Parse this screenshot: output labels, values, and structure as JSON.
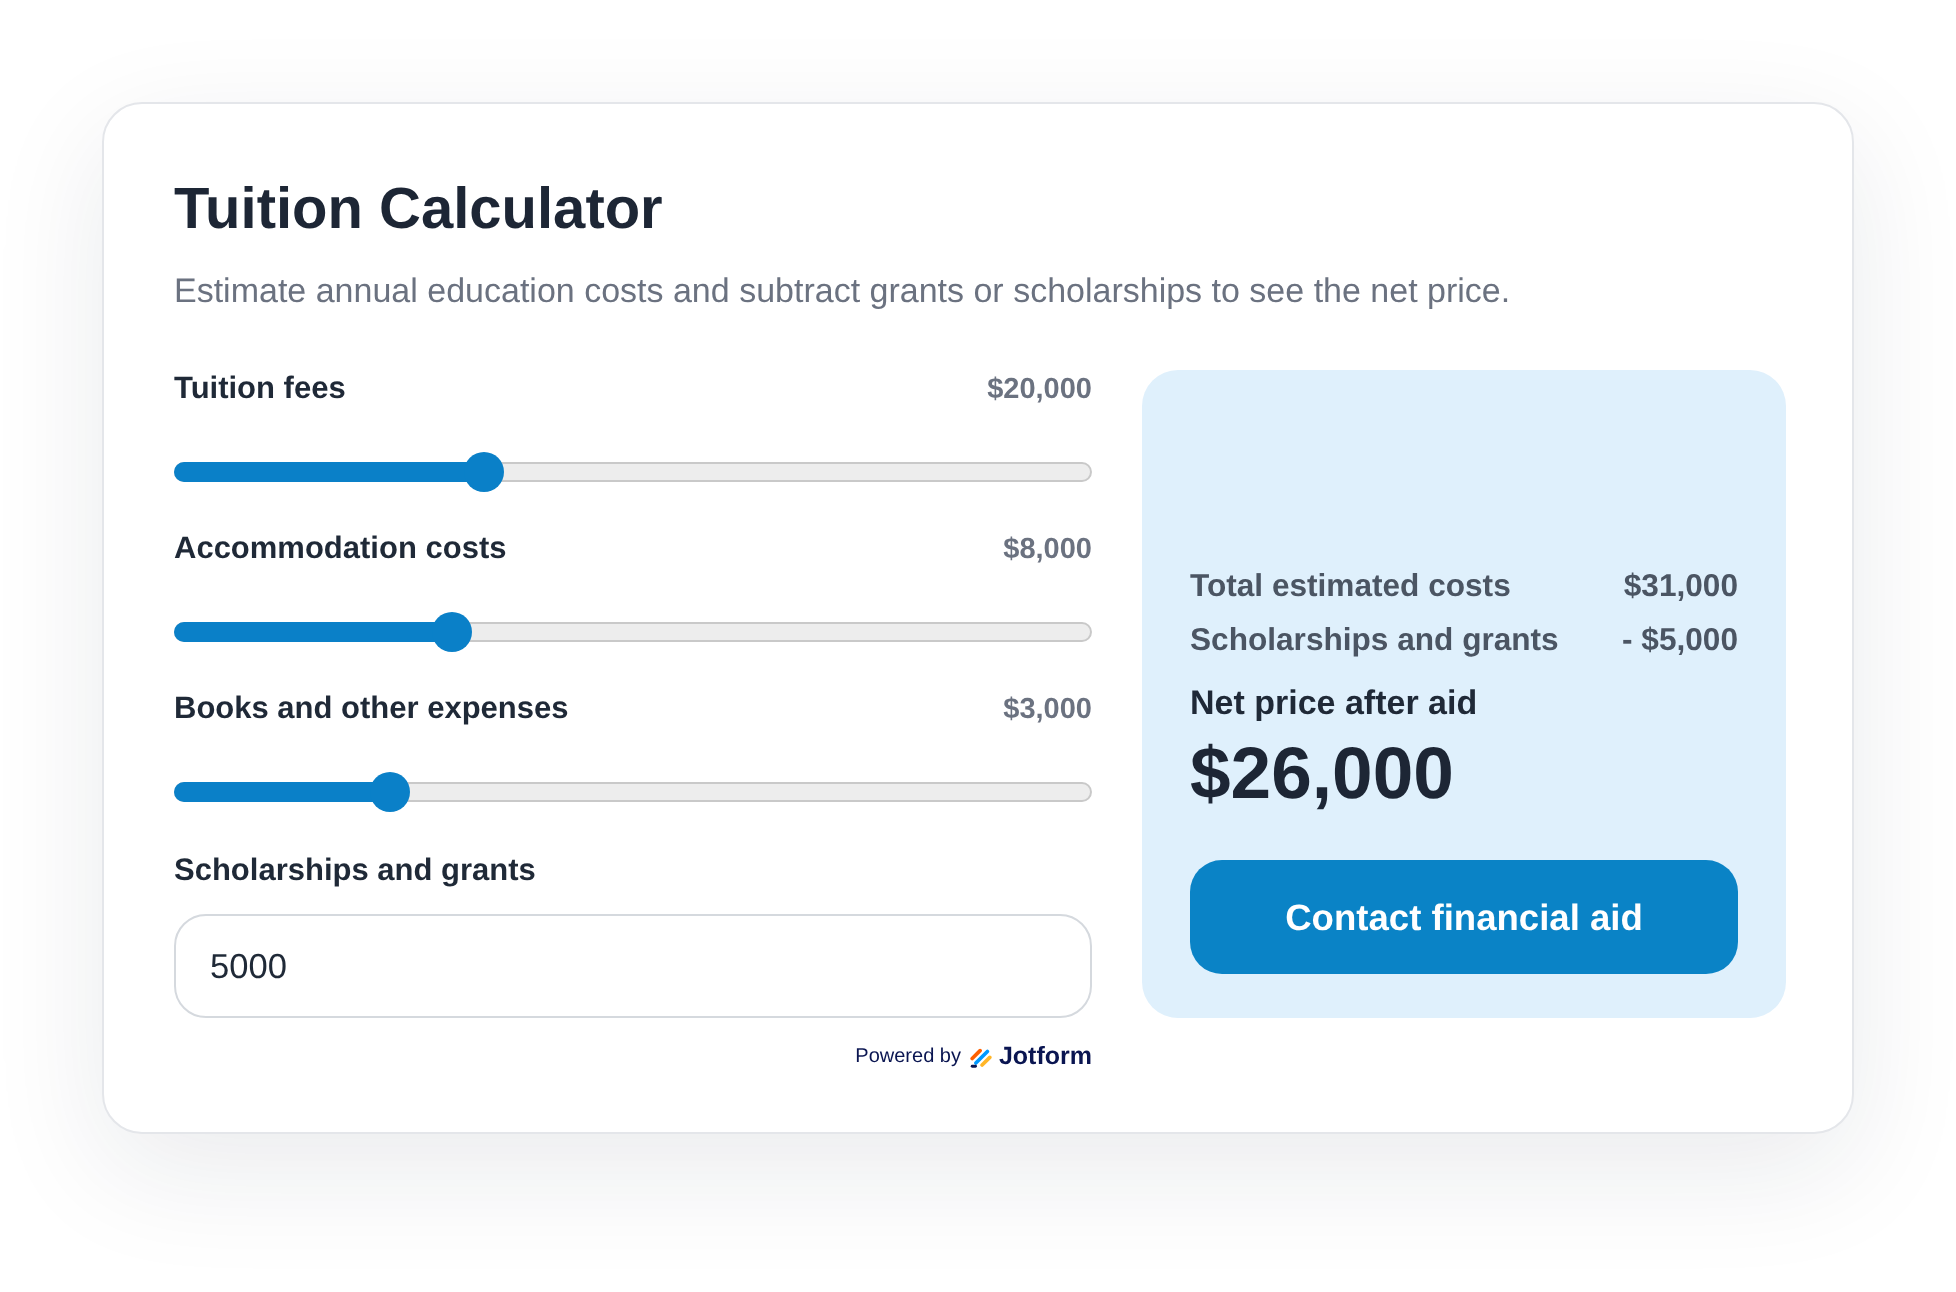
{
  "title": "Tuition Calculator",
  "subtitle": "Estimate annual education costs and subtract grants or scholarships to see the net price.",
  "sliders": [
    {
      "label": "Tuition fees",
      "value": "$20,000",
      "level": 0.338
    },
    {
      "label": "Accommodation costs",
      "value": "$8,000",
      "level": 0.303
    },
    {
      "label": "Books and other expenses",
      "value": "$3,000",
      "level": 0.235
    }
  ],
  "scholarships": {
    "label": "Scholarships and grants",
    "value": "5000"
  },
  "powered_by": {
    "text": "Powered by",
    "brand": "Jotform"
  },
  "summary": {
    "rows": [
      {
        "label": "Total estimated costs",
        "value": "$31,000"
      },
      {
        "label": "Scholarships and grants",
        "value": "- $5,000"
      }
    ],
    "net_label": "Net price after aid",
    "net_value": "$26,000",
    "button": "Contact financial aid"
  }
}
